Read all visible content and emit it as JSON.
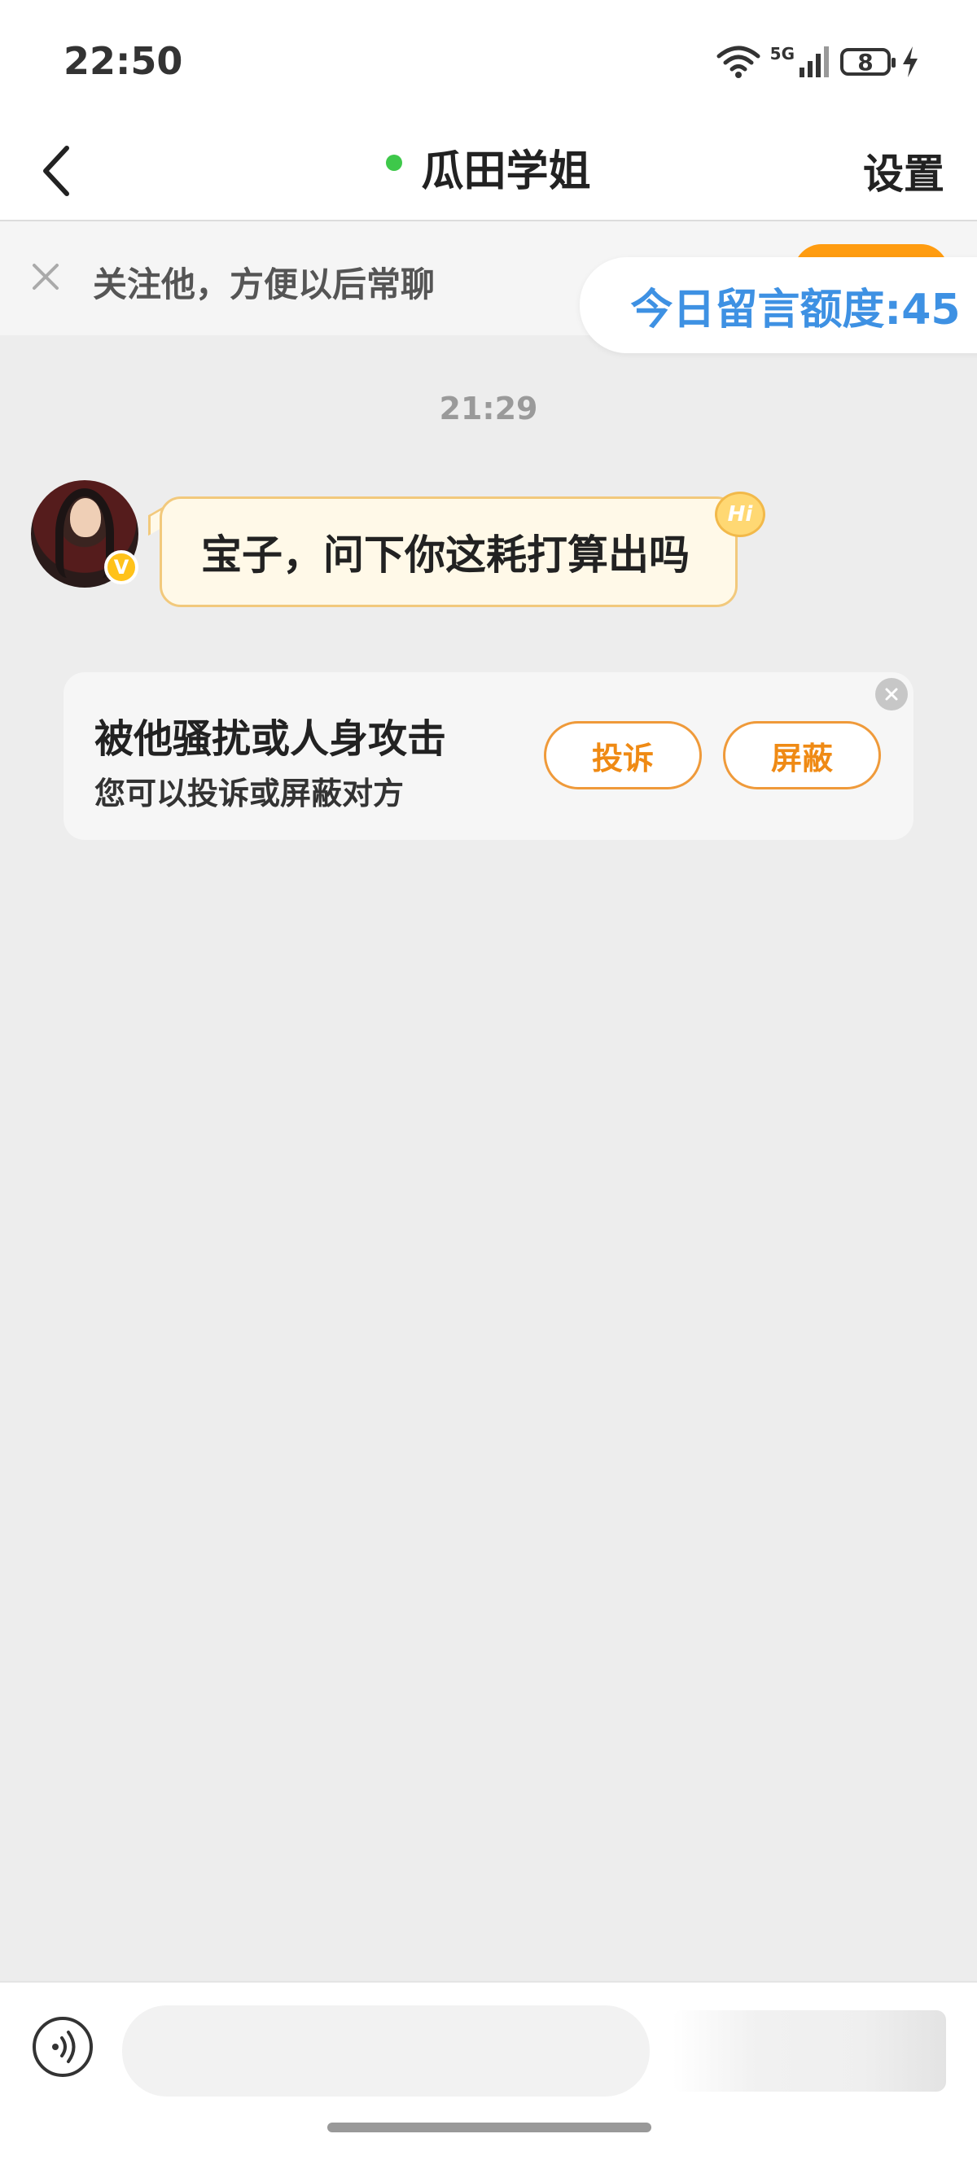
{
  "status_bar": {
    "time": "22:50",
    "network": "5G",
    "battery": "8"
  },
  "nav": {
    "title": "瓜田学姐",
    "settings_label": "设置"
  },
  "follow_banner": {
    "text": "关注他，方便以后常聊"
  },
  "quota": {
    "text": "今日留言额度:45"
  },
  "chat": {
    "timestamp": "21:29",
    "messages": [
      {
        "sender": "瓜田学姐",
        "text": "宝子，问下你这耗打算出吗",
        "badge": "Hi"
      }
    ]
  },
  "avatar": {
    "vip_badge": "V"
  },
  "report_card": {
    "title": "被他骚扰或人身攻击",
    "subtitle": "您可以投诉或屏蔽对方",
    "report_label": "投诉",
    "block_label": "屏蔽"
  },
  "colors": {
    "accent_orange": "#ef8a14",
    "quota_blue": "#3e91e3",
    "online_green": "#3ec84a",
    "bubble_bg": "#fff9e8"
  },
  "icons": [
    "back-arrow-icon",
    "close-icon",
    "wifi-icon",
    "signal-icon",
    "battery-icon",
    "charging-icon",
    "voice-icon"
  ]
}
